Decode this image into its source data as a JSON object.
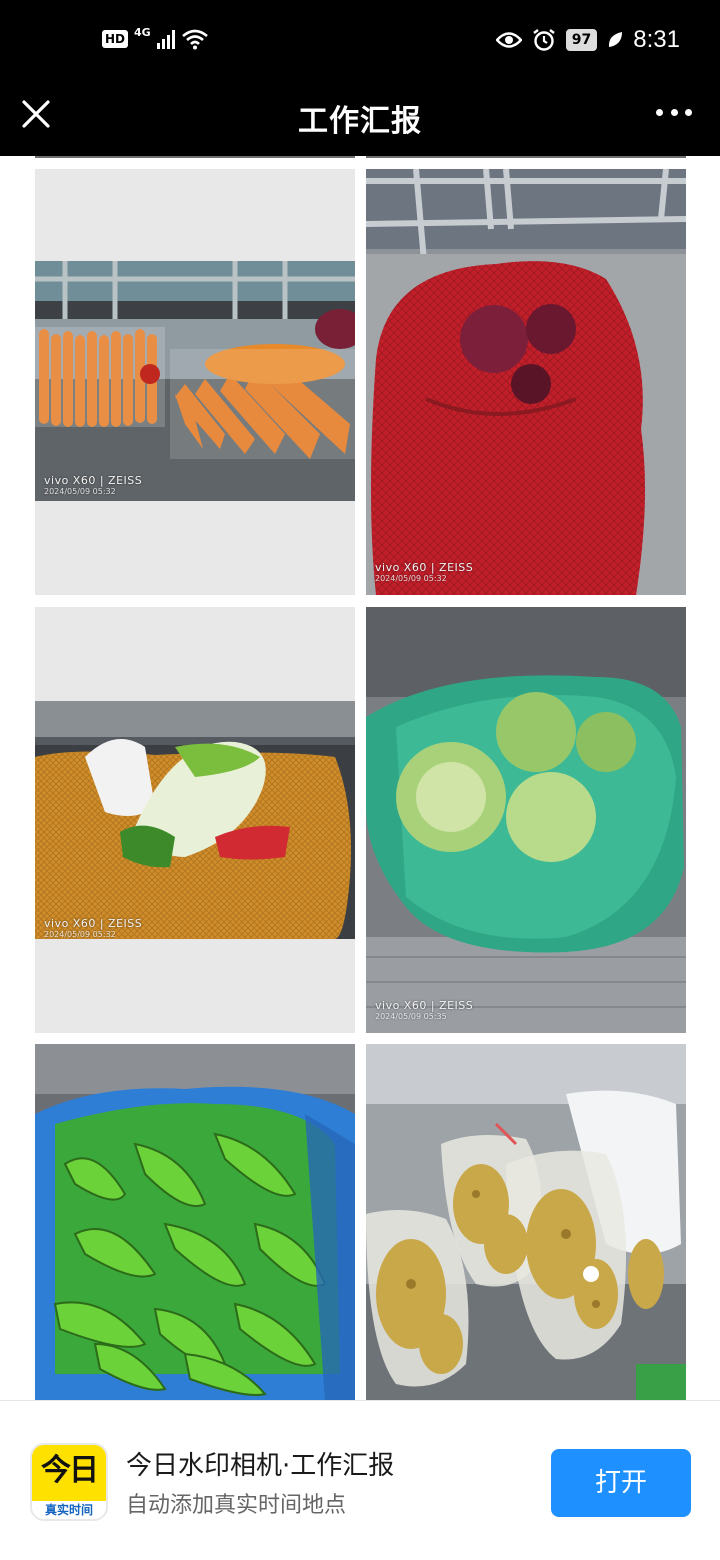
{
  "status_bar": {
    "hd_label": "HD",
    "network_label": "4G",
    "battery": "97",
    "time": "8:31",
    "icons": [
      "signal-icon",
      "wifi-icon",
      "eye-icon",
      "alarm-icon",
      "battery-icon",
      "leaf-icon"
    ]
  },
  "header": {
    "title": "工作汇报",
    "close_icon": "close-icon",
    "more_icon": "more-icon"
  },
  "photos": [
    {
      "subject": "carrots",
      "watermark_brand": "vivo X60 | ZEISS",
      "watermark_time": "2024/05/09 05:32"
    },
    {
      "subject": "red onions",
      "watermark_brand": "vivo X60 | ZEISS",
      "watermark_time": "2024/05/09 05:32"
    },
    {
      "subject": "napa cabbage",
      "watermark_brand": "vivo X60 | ZEISS",
      "watermark_time": "2024/05/09 05:32"
    },
    {
      "subject": "cabbage",
      "watermark_brand": "vivo X60 | ZEISS",
      "watermark_time": "2024/05/09 05:35"
    },
    {
      "subject": "green peppers",
      "watermark_brand": "",
      "watermark_time": ""
    },
    {
      "subject": "ginger",
      "watermark_brand": "",
      "watermark_time": ""
    }
  ],
  "banner": {
    "app_icon_text": "今日",
    "app_icon_subtext": "真实时间",
    "title": "今日水印相机·工作汇报",
    "subtitle": "自动添加真实时间地点",
    "open_button": "打开",
    "accent_color": "#1e90ff",
    "icon_color": "#ffe100"
  }
}
